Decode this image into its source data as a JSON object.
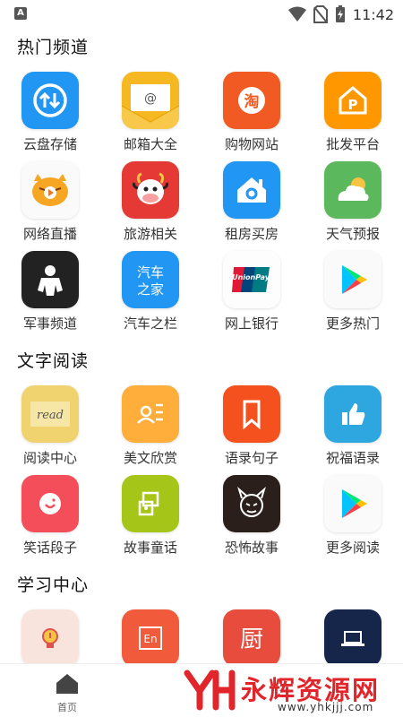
{
  "status_bar": {
    "time": "11:42",
    "notification_icon": "A"
  },
  "sections": [
    {
      "title": "热门频道",
      "items": [
        {
          "label": "云盘存储",
          "icon": "cloud-upload-icon",
          "color": "#2196f3"
        },
        {
          "label": "邮箱大全",
          "icon": "mail-envelope-icon",
          "color": "#f6b820"
        },
        {
          "label": "购物网站",
          "icon": "taobao-icon",
          "color": "#f15a22"
        },
        {
          "label": "批发平台",
          "icon": "store-p-icon",
          "color": "#ff9800"
        },
        {
          "label": "网络直播",
          "icon": "tiger-live-icon",
          "color": "#f6a623"
        },
        {
          "label": "旅游相关",
          "icon": "cow-icon",
          "color": "#e53935"
        },
        {
          "label": "租房买房",
          "icon": "house-icon",
          "color": "#2196f3"
        },
        {
          "label": "天气预报",
          "icon": "weather-icon",
          "color": "#5cb85c"
        },
        {
          "label": "军事频道",
          "icon": "soldier-icon",
          "color": "#222222"
        },
        {
          "label": "汽车之栏",
          "icon": "car-home-icon",
          "color": "#2196f3",
          "icon_text": "汽车之家"
        },
        {
          "label": "网上银行",
          "icon": "unionpay-icon",
          "color": "#ffffff"
        },
        {
          "label": "更多热门",
          "icon": "play-store-icon",
          "color": "#ffffff"
        }
      ]
    },
    {
      "title": "文字阅读",
      "items": [
        {
          "label": "阅读中心",
          "icon": "read-note-icon",
          "color": "#f0d36e",
          "icon_text": "read"
        },
        {
          "label": "美文欣赏",
          "icon": "profile-card-icon",
          "color": "#ffad3b"
        },
        {
          "label": "语录句子",
          "icon": "bookmark-icon",
          "color": "#f4511e"
        },
        {
          "label": "祝福语录",
          "icon": "thumbs-up-icon",
          "color": "#2ea7e0"
        },
        {
          "label": "笑话段子",
          "icon": "smile-icon",
          "color": "#f44e5a"
        },
        {
          "label": "故事童话",
          "icon": "story-icon",
          "color": "#a5c518"
        },
        {
          "label": "恐怖故事",
          "icon": "devil-icon",
          "color": "#2b1f1b"
        },
        {
          "label": "更多阅读",
          "icon": "play-store-icon",
          "color": "#ffffff"
        }
      ]
    },
    {
      "title": "学习中心",
      "items": [
        {
          "label": "",
          "icon": "lightbulb-icon",
          "color": "#f8e4dc"
        },
        {
          "label": "",
          "icon": "english-icon",
          "color": "#f15a3a",
          "icon_text": "En"
        },
        {
          "label": "",
          "icon": "kitchen-icon",
          "color": "#e84c3d",
          "icon_text": "厨"
        },
        {
          "label": "",
          "icon": "laptop-icon",
          "color": "#16254a"
        }
      ]
    }
  ],
  "bottom_nav": {
    "home_label": "首页",
    "tab2_label": "",
    "tab3_label": ""
  },
  "watermark": {
    "text": "永辉资源网",
    "url": "www.yhkjjj.com"
  }
}
